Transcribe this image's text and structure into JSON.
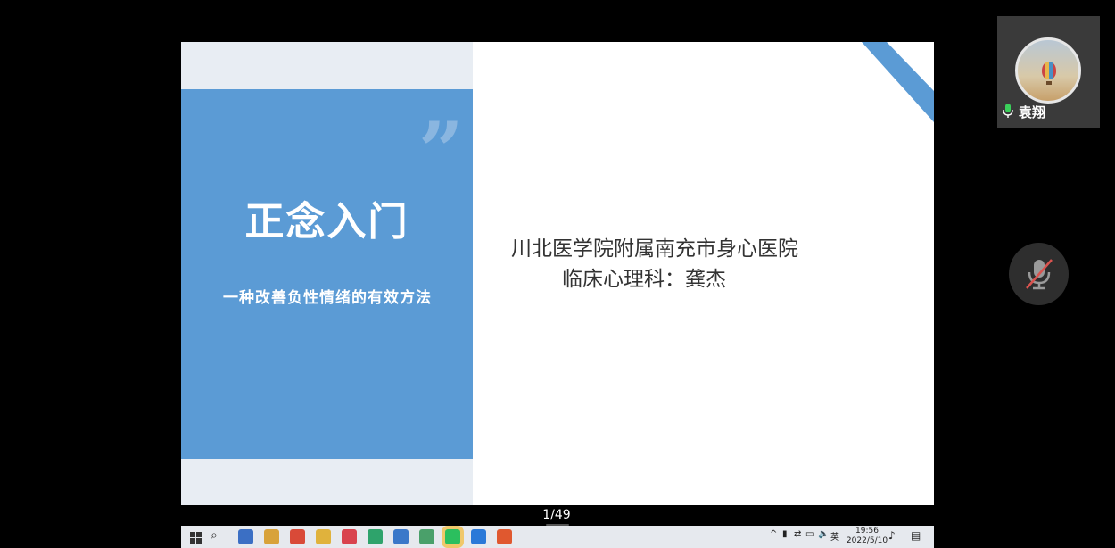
{
  "slide": {
    "title": "正念入门",
    "subtitle": "一种改善负性情绪的有效方法",
    "quote_mark": "”",
    "author_line1": "川北医学院附属南充市身心医院",
    "author_line2": "临床心理科：龚杰",
    "colors": {
      "accent": "#5b9bd5",
      "panel": "#e8edf3"
    }
  },
  "participant": {
    "name": "袁翔",
    "icon": "mic-active-icon"
  },
  "controls": {
    "mute_icon": "mic-muted-icon"
  },
  "pager": {
    "label": "1/49"
  },
  "taskbar": {
    "start_icon": "windows-start-icon",
    "search_icon": "search-icon",
    "apps": [
      {
        "name": "word-icon",
        "color": "#3b6fc4"
      },
      {
        "name": "folder-icon",
        "color": "#d8a23a"
      },
      {
        "name": "chrome-icon",
        "color": "#d94a38"
      },
      {
        "name": "explorer-icon",
        "color": "#e0b23c"
      },
      {
        "name": "pdf-icon",
        "color": "#d9434e"
      },
      {
        "name": "wps-sheet-icon",
        "color": "#2ea36b"
      },
      {
        "name": "browser-icon",
        "color": "#3a78c9"
      },
      {
        "name": "photos-icon",
        "color": "#4aa06a"
      },
      {
        "name": "wechat-icon",
        "color": "#2bbf5e"
      },
      {
        "name": "meeting-icon",
        "color": "#2a79d8"
      },
      {
        "name": "wps-ppt-icon",
        "color": "#e0582f"
      }
    ],
    "tray_lang": "英",
    "clock_time": "19:56",
    "clock_date": "2022/5/10"
  }
}
